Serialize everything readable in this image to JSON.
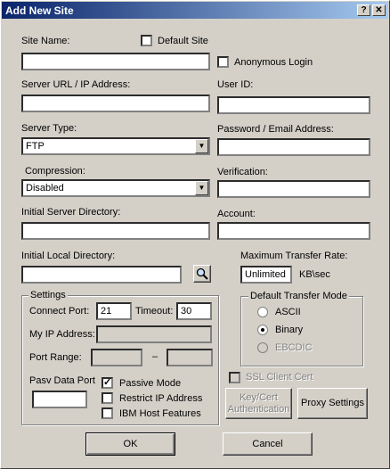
{
  "window": {
    "title": "Add New Site",
    "help_glyph": "?",
    "close_glyph": "✕"
  },
  "labels": {
    "site_name": "Site Name:",
    "default_site": "Default Site",
    "anonymous_login": "Anonymous Login",
    "server_url": "Server URL / IP Address:",
    "user_id": "User ID:",
    "server_type": "Server Type:",
    "password": "Password / Email Address:",
    "compression": "Compression:",
    "verification": "Verification:",
    "initial_server_dir": "Initial Server Directory:",
    "account": "Account:",
    "initial_local_dir": "Initial Local Directory:",
    "max_transfer_rate": "Maximum Transfer Rate:",
    "kb_sec": "KB\\sec"
  },
  "fields": {
    "site_name": "",
    "server_url": "",
    "user_id": "",
    "password": "",
    "verification": "",
    "initial_server_dir": "",
    "account": "",
    "initial_local_dir": "",
    "max_transfer_rate": "Unlimited"
  },
  "dropdowns": {
    "server_type": "FTP",
    "compression": "Disabled"
  },
  "checkboxes": {
    "default_site": false,
    "anonymous_login": false,
    "passive_mode": true,
    "restrict_ip": false,
    "ibm_host": false,
    "ssl_client_cert": false
  },
  "settings": {
    "title": "Settings",
    "connect_port_label": "Connect Port:",
    "connect_port": "21",
    "timeout_label": "Timeout:",
    "timeout": "30",
    "my_ip_label": "My IP Address:",
    "my_ip": "",
    "port_range_label": "Port Range:",
    "port_range_dash": "–",
    "pasv_data_port_label": "Pasv Data Port",
    "pasv_data_port": "",
    "passive_mode": "Passive Mode",
    "restrict_ip": "Restrict IP Address",
    "ibm_host": "IBM Host Features"
  },
  "transfer_mode": {
    "title": "Default Transfer Mode",
    "options": [
      "ASCII",
      "Binary",
      "EBCDIC"
    ],
    "selected": "Binary"
  },
  "ssl_client_cert": "SSL Client Cert",
  "buttons": {
    "key_cert": "Key/Cert Authentication",
    "proxy": "Proxy Settings",
    "ok": "OK",
    "cancel": "Cancel"
  }
}
